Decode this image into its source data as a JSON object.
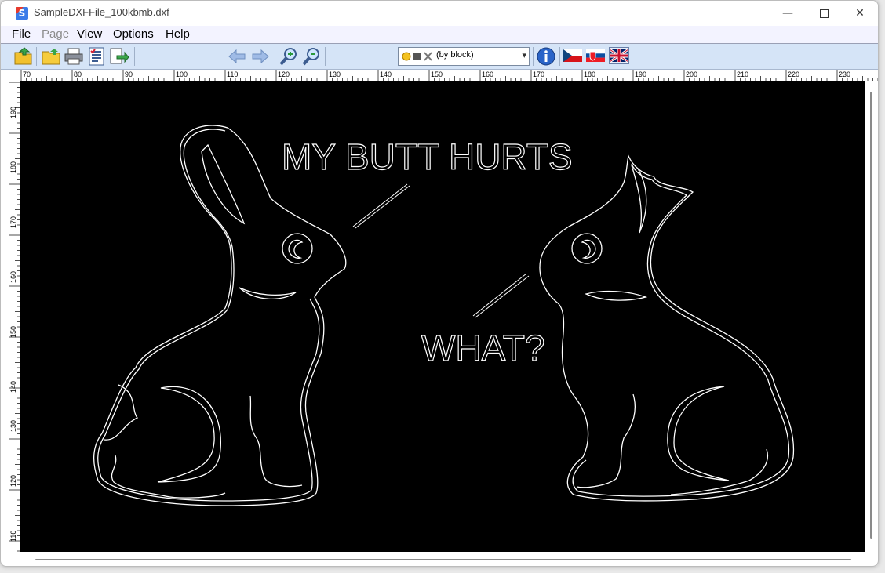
{
  "window": {
    "title": "SampleDXFFile_100kbmb.dxf",
    "app_icon_letter": "S"
  },
  "menu": [
    {
      "label": "File",
      "enabled": true
    },
    {
      "label": "Page",
      "enabled": false
    },
    {
      "label": "View",
      "enabled": true
    },
    {
      "label": "Options",
      "enabled": true
    },
    {
      "label": "Help",
      "enabled": true
    }
  ],
  "toolbar": {
    "layer_select_value": "(by block)",
    "icons": [
      "open-icon",
      "open-folder-icon",
      "print-icon",
      "properties-icon",
      "export-icon",
      "arrow-left-icon",
      "arrow-right-icon",
      "zoom-in-icon",
      "zoom-out-icon",
      "layer-icons",
      "info-icon",
      "flag-cz-icon",
      "flag-sk-icon",
      "flag-uk-icon"
    ]
  },
  "ruler": {
    "horizontal_labels": [
      "70",
      "80",
      "90",
      "100",
      "110",
      "120",
      "130",
      "140",
      "150",
      "160",
      "170",
      "180",
      "190",
      "200",
      "210",
      "220",
      "230"
    ],
    "vertical_labels": [
      "190",
      "180",
      "170",
      "160",
      "150",
      "140",
      "130",
      "120",
      "110"
    ]
  },
  "drawing": {
    "text_left": "MY BUTT HURTS",
    "text_right": "WHAT?",
    "background": "#000000",
    "stroke": "#ffffff"
  }
}
